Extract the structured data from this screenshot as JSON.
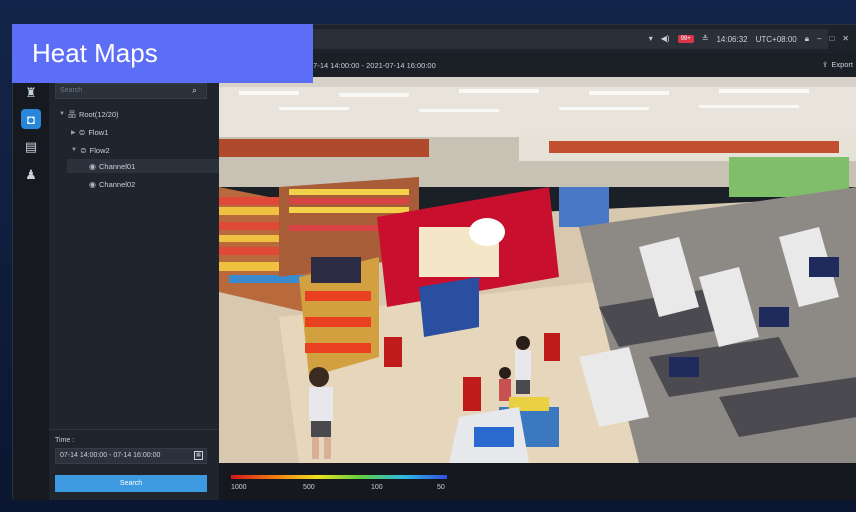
{
  "banner": {
    "title": "Heat Maps"
  },
  "topbar": {
    "badge": "99+",
    "clock": "14:06:32",
    "timezone": "UTC+08:00"
  },
  "subbar": {
    "range": "07-14 14:00:00 - 2021-07-14 16:00:00",
    "export_label": "Export"
  },
  "sidebar": {
    "search_placeholder": "Search",
    "tree": {
      "root": "Root(12/20)",
      "flow1": "Flow1",
      "flow2": "Flow2",
      "channel01": "Channel01",
      "channel02": "Channel02"
    },
    "time_label": "Time :",
    "time_value": "07-14 14:00:00 - 07-14 16:00:00",
    "search_button": "Search"
  },
  "legend": {
    "labels": [
      "1000",
      "500",
      "100",
      "50"
    ]
  },
  "icons": {
    "rail": [
      "person-icon",
      "monitor-icon",
      "document-icon",
      "user-group-icon"
    ]
  }
}
